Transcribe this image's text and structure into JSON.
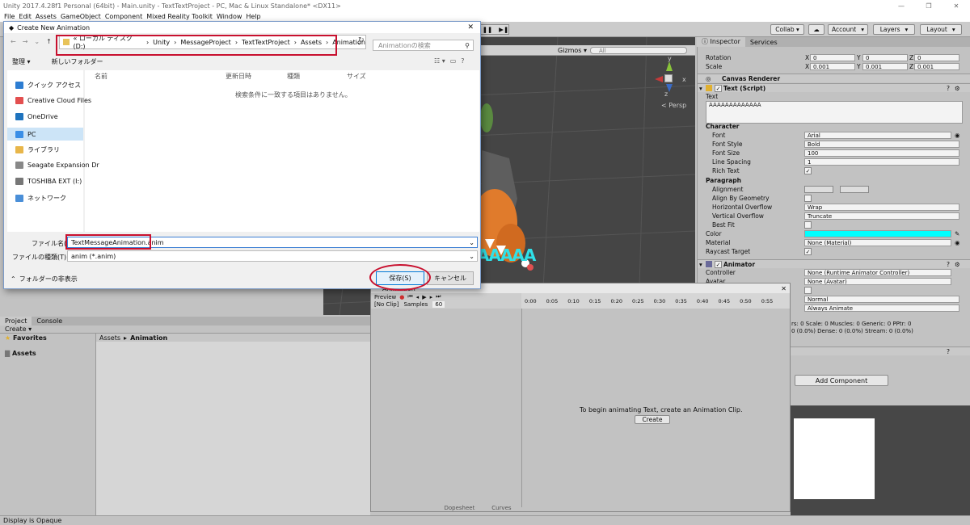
{
  "window": {
    "title": "Unity 2017.4.28f1 Personal (64bit) - Main.unity - TextTextProject - PC, Mac & Linux Standalone* <DX11>"
  },
  "menu": [
    "File",
    "Edit",
    "Assets",
    "GameObject",
    "Component",
    "Mixed Reality Toolkit",
    "Window",
    "Help"
  ],
  "toolbar": {
    "collab": "Collab ▾",
    "account": "Account",
    "layers": "Layers",
    "layout": "Layout"
  },
  "scene": {
    "gizmos": "Gizmos ▾",
    "search_placeholder": "All",
    "persp": "< Persp",
    "text_fragment": "AAAAA",
    "axis_y": "y",
    "axis_x": "x",
    "axis_z": "z"
  },
  "inspector": {
    "tabs": [
      "Inspector",
      "Services"
    ],
    "rotation": {
      "label": "Rotation",
      "x": "0",
      "y": "0",
      "z": "0"
    },
    "scale": {
      "label": "Scale",
      "x": "0.001",
      "y": "0.001",
      "z": "0.001"
    },
    "axis_x": "X",
    "axis_y": "Y",
    "axis_z": "Z",
    "canvas_renderer": "Canvas Renderer",
    "text_script": "Text (Script)",
    "text_label": "Text",
    "text_value": "AAAAAAAAAAAAA",
    "character": "Character",
    "font": {
      "label": "Font",
      "value": "Arial"
    },
    "font_style": {
      "label": "Font Style",
      "value": "Bold"
    },
    "font_size": {
      "label": "Font Size",
      "value": "100"
    },
    "line_spacing": {
      "label": "Line Spacing",
      "value": "1"
    },
    "rich_text": {
      "label": "Rich Text"
    },
    "paragraph": "Paragraph",
    "alignment": {
      "label": "Alignment"
    },
    "align_geometry": {
      "label": "Align By Geometry"
    },
    "h_overflow": {
      "label": "Horizontal Overflow",
      "value": "Wrap"
    },
    "v_overflow": {
      "label": "Vertical Overflow",
      "value": "Truncate"
    },
    "best_fit": {
      "label": "Best Fit"
    },
    "color": {
      "label": "Color",
      "value": "#00ffff"
    },
    "material": {
      "label": "Material",
      "value": "None (Material)"
    },
    "raycast": {
      "label": "Raycast Target"
    },
    "animator": "Animator",
    "controller": {
      "label": "Controller",
      "value": "None (Runtime Animator Controller)"
    },
    "avatar": {
      "label": "Avatar",
      "value": "None (Avatar)"
    },
    "update_mode": "Normal",
    "culling_mode": "Always Animate",
    "stats": "rs: 0 Scale: 0 Muscles: 0 Generic: 0 PPtr: 0",
    "stats2": "0 (0.0%) Dense: 0 (0.0%) Stream: 0 (0.0%)",
    "add_component": "Add Component"
  },
  "project": {
    "tabs": [
      "Project",
      "Console"
    ],
    "create": "Create ▾",
    "favorites": "Favorites",
    "assets": "Assets",
    "breadcrumb": [
      "Assets",
      "Animation"
    ]
  },
  "animation": {
    "title": "Animation",
    "preview": "Preview",
    "clip": "[No Clip]",
    "samples_label": "Samples",
    "samples": "60",
    "timeline": [
      "0:00",
      "0:05",
      "0:10",
      "0:15",
      "0:20",
      "0:25",
      "0:30",
      "0:35",
      "0:40",
      "0:45",
      "0:50",
      "0:55"
    ],
    "message": "To begin animating Text, create an Animation Clip.",
    "create": "Create",
    "dopesheet": "Dopesheet",
    "curves": "Curves"
  },
  "status": "Display is Opaque",
  "dialog": {
    "title": "Create New Animation",
    "path": [
      "« ローカル ディスク (D:)",
      "Unity",
      "MessageProject",
      "TextTextProject",
      "Assets",
      "Animation"
    ],
    "search_placeholder": "Animationの検索",
    "organize": "整理 ▾",
    "new_folder": "新しいフォルダー",
    "columns": [
      "名前",
      "更新日時",
      "種類",
      "サイズ"
    ],
    "empty_message": "検索条件に一致する項目はありません。",
    "nav": [
      {
        "label": "クイック アクセス",
        "color": "#2d7dd2"
      },
      {
        "label": "Creative Cloud Files",
        "color": "#e34f4f"
      },
      {
        "label": "OneDrive",
        "color": "#1e73be"
      },
      {
        "label": "PC",
        "color": "#3a8ee6"
      },
      {
        "label": "ライブラリ",
        "color": "#e8b64a"
      },
      {
        "label": "Seagate Expansion Dr",
        "color": "#888888"
      },
      {
        "label": "TOSHIBA EXT (I:)",
        "color": "#777777"
      },
      {
        "label": "ネットワーク",
        "color": "#4a8fd8"
      }
    ],
    "filename_label": "ファイル名(N):",
    "filename_value": "TextMessageAnimation.anim",
    "filetype_label": "ファイルの種類(T):",
    "filetype_value": "anim (*.anim)",
    "hide_folders": "フォルダーの非表示",
    "save": "保存(S)",
    "cancel": "キャンセル"
  },
  "colors": {
    "annotation": "#c8102e",
    "cyan": "#00ffff",
    "dialog_border": "#7a9ac8"
  }
}
